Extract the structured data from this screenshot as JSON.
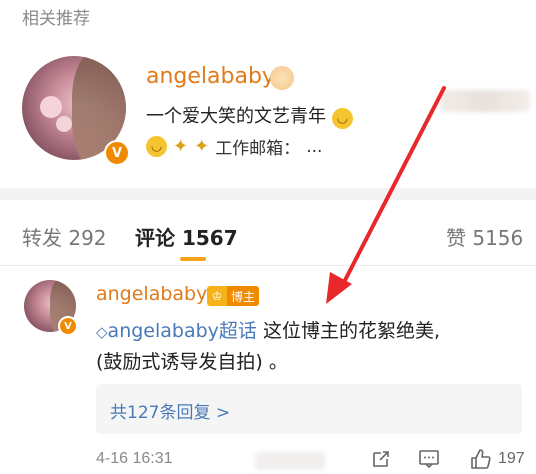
{
  "section": {
    "label": "相关推荐"
  },
  "recommended_user": {
    "name": "angelababy",
    "bio": "一个爱大笑的文艺青年",
    "line3_text": "工作邮箱：",
    "line3_ellipsis": "...",
    "verified_badge": "V"
  },
  "tabs": [
    {
      "label": "转发 292"
    },
    {
      "label": "评论 1567"
    },
    {
      "label": "赞 5156"
    }
  ],
  "comment": {
    "username": "angelababy",
    "badge_text": "博主",
    "topic_prefix": "◇",
    "topic": "angelababy超话",
    "text_line1": " 这位博主的花絮绝美,",
    "text_line2": "(鼓励式诱导发自拍) 。",
    "replies_label": "共127条回复 >",
    "time": "4-16 16:31",
    "like_count": "197",
    "verified_badge": "V"
  },
  "colors": {
    "username": "#e07a1a",
    "topic_link": "#4a79b8",
    "tab_active_underline": "#f7a21a",
    "annotation_arrow": "#e8282b"
  }
}
